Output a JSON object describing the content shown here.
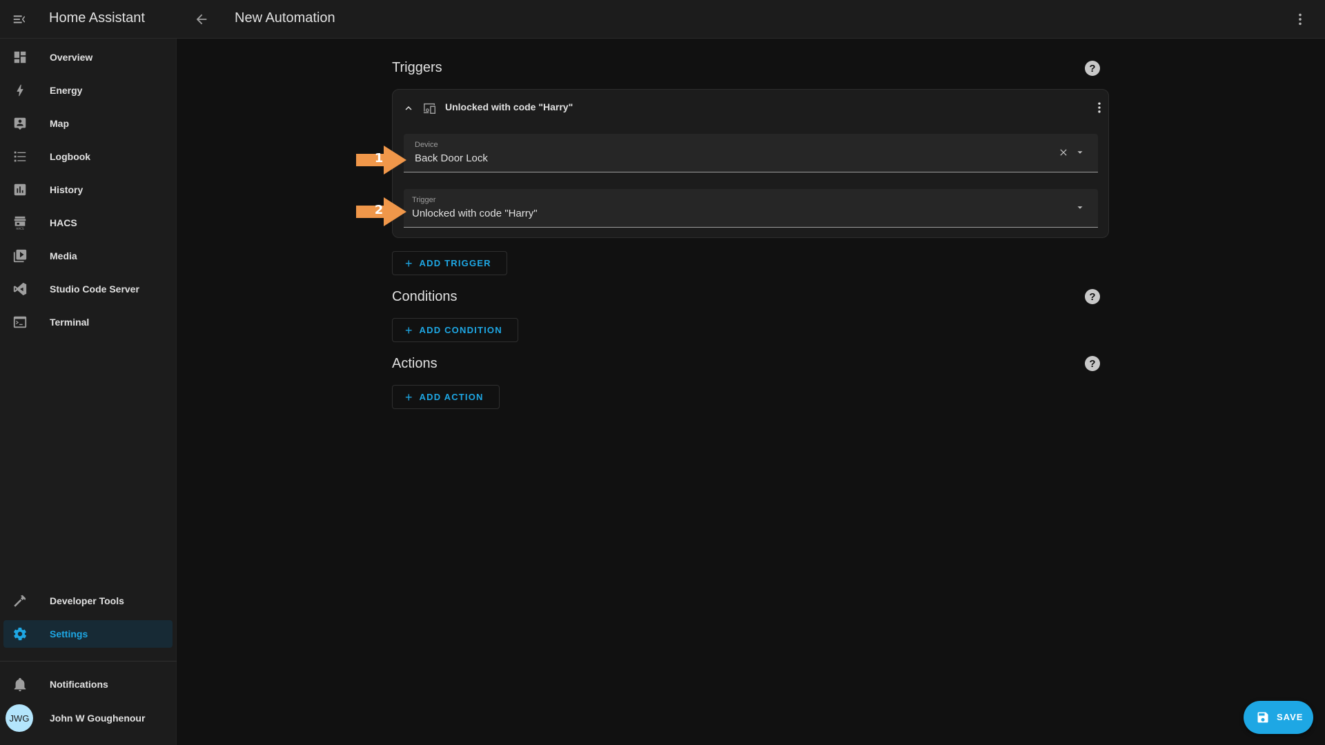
{
  "header": {
    "app_title": "Home Assistant",
    "page_title": "New Automation",
    "menu_icon": "menu-collapse-icon",
    "back_icon": "arrow-left-icon",
    "overflow_icon": "dots-vertical-icon"
  },
  "sidebar": {
    "items": [
      {
        "label": "Overview",
        "icon": "view-dashboard-icon"
      },
      {
        "label": "Energy",
        "icon": "lightning-bolt-icon"
      },
      {
        "label": "Map",
        "icon": "map-account-icon"
      },
      {
        "label": "Logbook",
        "icon": "format-list-bulleted-icon"
      },
      {
        "label": "History",
        "icon": "chart-box-icon"
      },
      {
        "label": "HACS",
        "icon": "hacs-store-icon"
      },
      {
        "label": "Media",
        "icon": "play-box-multiple-icon"
      },
      {
        "label": "Studio Code Server",
        "icon": "vscode-icon"
      },
      {
        "label": "Terminal",
        "icon": "console-icon"
      }
    ],
    "bottom_items": [
      {
        "label": "Developer Tools",
        "icon": "hammer-icon"
      },
      {
        "label": "Settings",
        "icon": "cog-icon",
        "active": true
      }
    ],
    "notifications_label": "Notifications",
    "user": {
      "name": "John W Goughenour",
      "initials": "JWG"
    }
  },
  "main": {
    "triggers": {
      "title": "Triggers",
      "cards": [
        {
          "title": "Unlocked with code \"Harry\"",
          "device_field": {
            "label": "Device",
            "value": "Back Door Lock"
          },
          "trigger_field": {
            "label": "Trigger",
            "value": "Unlocked with code \"Harry\""
          }
        }
      ],
      "add_label": "ADD TRIGGER"
    },
    "conditions": {
      "title": "Conditions",
      "add_label": "ADD CONDITION"
    },
    "actions": {
      "title": "Actions",
      "add_label": "ADD ACTION"
    },
    "help_glyph": "?"
  },
  "callouts": [
    {
      "number": "1"
    },
    {
      "number": "2"
    }
  ],
  "save_button": {
    "label": "SAVE",
    "icon": "content-save-icon"
  },
  "colors": {
    "accent": "#1ea7e4",
    "background": "#111111",
    "surface": "#1c1c1c",
    "callout": "#f0974a"
  }
}
